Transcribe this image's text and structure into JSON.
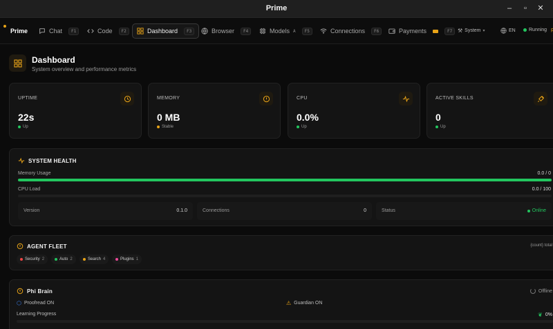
{
  "window": {
    "title": "Prime",
    "min_label": "–",
    "max_label": "▫",
    "close_label": "✕"
  },
  "nav": {
    "brand": "Prime",
    "tabs": [
      {
        "label": "Chat",
        "key": "F1",
        "icon": "chat-bubble-icon"
      },
      {
        "label": "Code",
        "key": "F2",
        "icon": "code-icon"
      },
      {
        "label": "Dashboard",
        "key": "F3",
        "icon": "grid-icon"
      },
      {
        "label": "Browser",
        "key": "F4",
        "icon": "globe-icon"
      },
      {
        "label": "Models",
        "badge": "A",
        "key": "F5",
        "icon": "cpu-icon"
      },
      {
        "label": "Connections",
        "key": "F6",
        "icon": "wifi-icon"
      },
      {
        "label": "Payments",
        "key": "F7",
        "icon": "wallet-icon"
      }
    ],
    "system_label": "System",
    "language": "EN",
    "status": "Running",
    "status_tail": "p"
  },
  "page": {
    "title": "Dashboard",
    "subtitle": "System overview and performance metrics"
  },
  "stats": [
    {
      "label": "UPTIME",
      "value": "22s",
      "status": "Up",
      "status_color": "#22c55e",
      "icon": "clock-icon"
    },
    {
      "label": "MEMORY",
      "value": "0 MB",
      "status": "Stable",
      "status_color": "#e8a317",
      "icon": "info-icon"
    },
    {
      "label": "CPU",
      "value": "0.0%",
      "status": "Up",
      "status_color": "#22c55e",
      "icon": "activity-icon"
    },
    {
      "label": "ACTIVE SKILLS",
      "value": "0",
      "status": "Up",
      "status_color": "#22c55e",
      "icon": "plug-icon"
    }
  ],
  "health": {
    "title": "SYSTEM HEALTH",
    "memory_label": "Memory Usage",
    "memory_value": "0.0 / 0",
    "memory_fill": 1.0,
    "cpu_label": "CPU Load",
    "cpu_value": "0.0 / 100",
    "cpu_fill": 0.0,
    "version_label": "Version",
    "version_value": "0.1.0",
    "connections_label": "Connections",
    "connections_value": "0",
    "status_label": "Status",
    "status_value": "Online"
  },
  "fleet": {
    "title": "AGENT FLEET",
    "total": "{count} total",
    "chips": [
      {
        "label": "Security",
        "count": "2",
        "color": "#ef4444"
      },
      {
        "label": "Auto",
        "count": "2",
        "color": "#22c55e"
      },
      {
        "label": "Search",
        "count": "4",
        "color": "#e8a317"
      },
      {
        "label": "Plugins",
        "count": "1",
        "color": "#ec4899"
      }
    ]
  },
  "brain": {
    "title": "Phi Brain",
    "status": "Offline",
    "proofread": "Proofread ON",
    "guardian": "Guardian ON",
    "learning_label": "Learning Progress",
    "learning_value": "0%"
  },
  "colors": {
    "accent": "#e8a317",
    "green": "#22c55e",
    "bg": "#0b0b0b",
    "card": "#141414"
  }
}
